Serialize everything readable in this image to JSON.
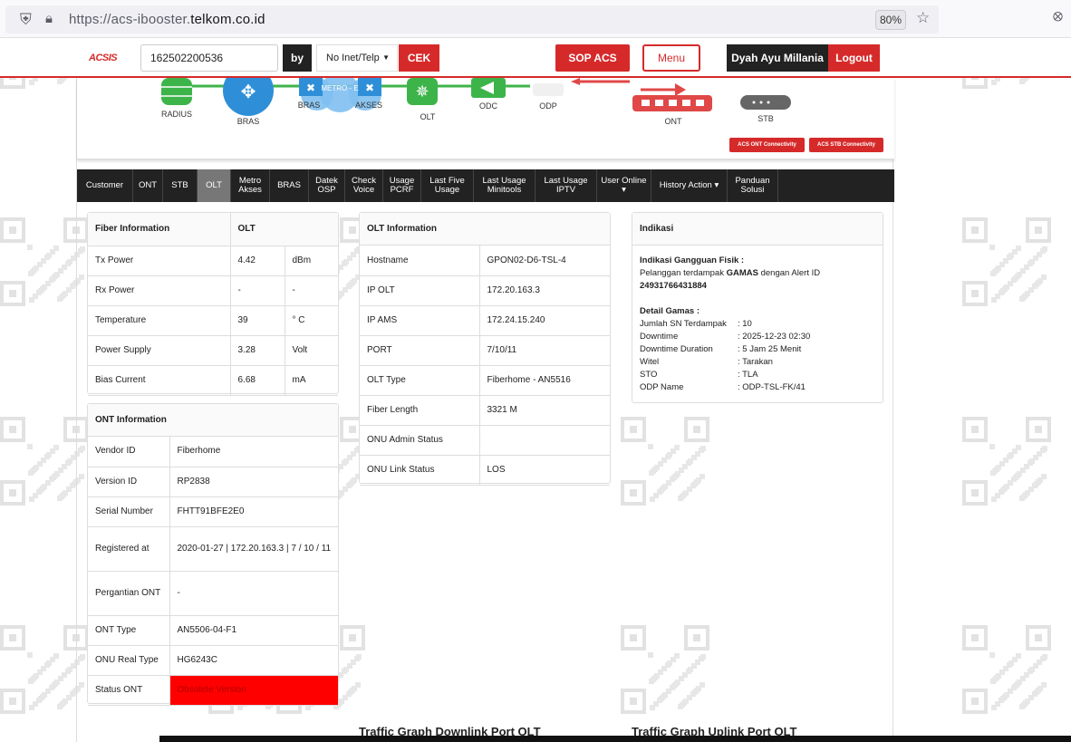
{
  "browser": {
    "url_prefix": "https://acs-ibooster.",
    "url_domain": "telkom.co.id",
    "zoom": "80%"
  },
  "header": {
    "logo": "ACSIS",
    "search_value": "162502200536",
    "by_label": "by",
    "select_value": "No Inet/Telp",
    "cek_label": "CEK",
    "sop_label": "SOP ACS",
    "menu_label": "Menu",
    "user_name": "Dyah Ayu Millania",
    "logout_label": "Logout"
  },
  "topology": {
    "labels": [
      "RADIUS",
      "BRAS",
      "BRAS",
      "METRO - E",
      "AKSES",
      "OLT",
      "ODC",
      "ODP",
      "ONT",
      "STB"
    ],
    "ont_conn_label": "ACS ONT Connectivity",
    "stb_conn_label": "ACS STB Connectivity"
  },
  "tabs": [
    {
      "label": "Customer"
    },
    {
      "label": "ONT"
    },
    {
      "label": "STB"
    },
    {
      "label": "OLT"
    },
    {
      "label": "Metro\nAkses"
    },
    {
      "label": "BRAS"
    },
    {
      "label": "Datek\nOSP"
    },
    {
      "label": "Check\nVoice"
    },
    {
      "label": "Usage\nPCRF"
    },
    {
      "label": "Last Five\nUsage"
    },
    {
      "label": "Last Usage\nMinitools"
    },
    {
      "label": "Last Usage\nIPTV"
    },
    {
      "label": "User Online ▾"
    },
    {
      "label": "History Action ▾"
    },
    {
      "label": "Panduan\nSolusi"
    }
  ],
  "fiber": {
    "title": "Fiber Information",
    "col": "OLT",
    "rows": [
      {
        "label": "Tx Power",
        "value": "4.42",
        "unit": "dBm"
      },
      {
        "label": "Rx Power",
        "value": "-",
        "unit": "-"
      },
      {
        "label": "Temperature",
        "value": "39",
        "unit": "° C"
      },
      {
        "label": "Power Supply",
        "value": "3.28",
        "unit": "Volt"
      },
      {
        "label": "Bias Current",
        "value": "6.68",
        "unit": "mA"
      }
    ]
  },
  "ont": {
    "title": "ONT Information",
    "rows": [
      {
        "label": "Vendor ID",
        "value": "Fiberhome"
      },
      {
        "label": "Version ID",
        "value": "RP2838"
      },
      {
        "label": "Serial Number",
        "value": "FHTT91BFE2E0"
      },
      {
        "label": "Registered at",
        "value": "2020-01-27 | 172.20.163.3 | 7 / 10 / 11"
      },
      {
        "label": "Pergantian ONT",
        "value": "-"
      },
      {
        "label": "ONT Type",
        "value": "AN5506-04-F1"
      },
      {
        "label": "ONU Real Type",
        "value": "HG6243C"
      },
      {
        "label": "Status ONT",
        "value": "Obsolete Version"
      }
    ]
  },
  "olt": {
    "title": "OLT Information",
    "rows": [
      {
        "label": "Hostname",
        "value": "GPON02-D6-TSL-4"
      },
      {
        "label": "IP OLT",
        "value": "172.20.163.3"
      },
      {
        "label": "IP AMS",
        "value": "172.24.15.240"
      },
      {
        "label": "PORT",
        "value": "7/10/11"
      },
      {
        "label": "OLT Type",
        "value": "Fiberhome - AN5516"
      },
      {
        "label": "Fiber Length",
        "value": "3321 M"
      },
      {
        "label": "ONU Admin Status",
        "value": ""
      },
      {
        "label": "ONU Link Status",
        "value": "LOS"
      }
    ]
  },
  "indikasi": {
    "title": "Indikasi",
    "fisik_title": "Indikasi Gangguan Fisik :",
    "fisik_pre": "Pelanggan terdampak ",
    "fisik_bold": "GAMAS",
    "fisik_post": " dengan Alert ID",
    "alert_id": "24931766431884",
    "detail_title": "Detail Gamas :",
    "details": [
      {
        "k": "Jumlah SN Terdampak",
        "v": ": 10"
      },
      {
        "k": "Downtime",
        "v": ": 2025-12-23 02:30"
      },
      {
        "k": "Downtime Duration",
        "v": ": 5 Jam 25 Menit"
      },
      {
        "k": "Witel",
        "v": ": Tarakan"
      },
      {
        "k": "STO",
        "v": ": TLA"
      },
      {
        "k": "ODP Name",
        "v": ": ODP-TSL-FK/41"
      }
    ]
  },
  "graphs": {
    "downlink": "Traffic Graph Downlink Port OLT",
    "uplink": "Traffic Graph Uplink Port OLT"
  }
}
